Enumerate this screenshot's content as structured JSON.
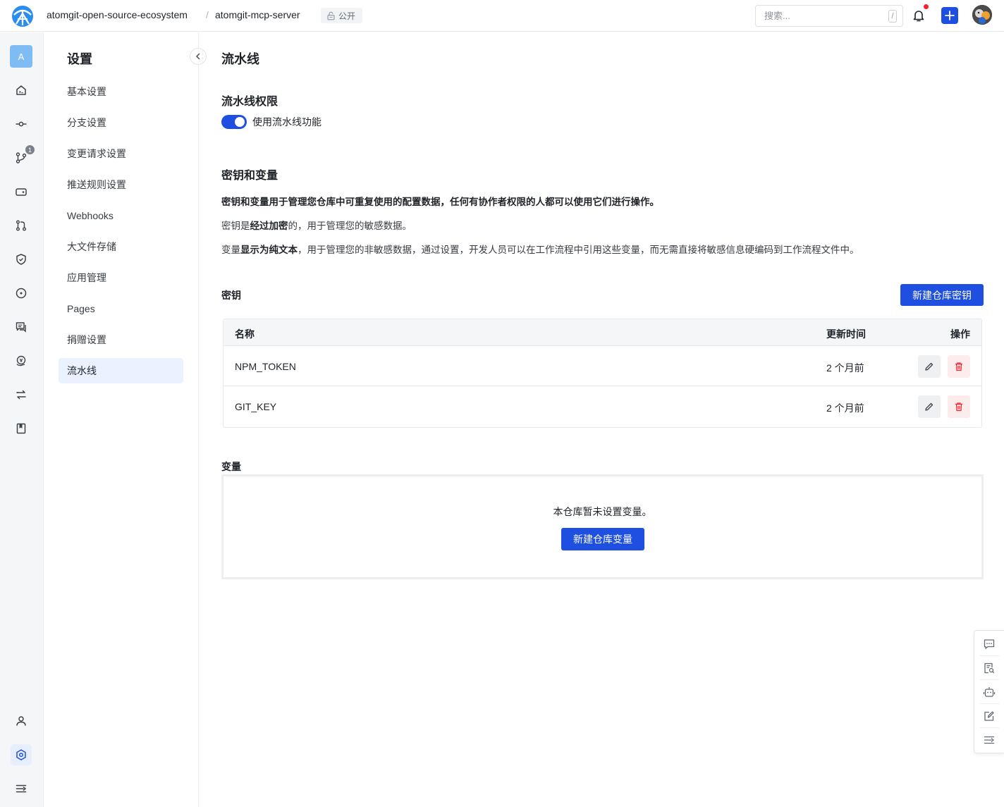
{
  "header": {
    "org": "atomgit-open-source-ecosystem",
    "separator": "/",
    "repo": "atomgit-mcp-server",
    "visibility": "公开",
    "search_placeholder": "搜索...",
    "search_shortcut": "/"
  },
  "rail": {
    "avatar_letter": "A",
    "badge_count": "1",
    "icons": [
      "home-icon",
      "commit-icon",
      "branch-icon",
      "tag-icon",
      "merge-request-icon",
      "security-icon",
      "issue-icon",
      "discussion-icon",
      "donation-icon",
      "sync-icon",
      "wiki-icon",
      "member-icon",
      "settings-icon",
      "expand-icon"
    ]
  },
  "sidebar": {
    "title": "设置",
    "items": [
      {
        "label": "基本设置"
      },
      {
        "label": "分支设置"
      },
      {
        "label": "变更请求设置"
      },
      {
        "label": "推送规则设置"
      },
      {
        "label": "Webhooks"
      },
      {
        "label": "大文件存储"
      },
      {
        "label": "应用管理"
      },
      {
        "label": "Pages"
      },
      {
        "label": "捐赠设置"
      },
      {
        "label": "流水线",
        "active": true
      }
    ]
  },
  "main": {
    "title": "流水线",
    "permission": {
      "heading": "流水线权限",
      "toggle_label": "使用流水线功能",
      "enabled": true
    },
    "secrets_vars": {
      "heading": "密钥和变量",
      "intro": "密钥和变量用于管理您仓库中可重复使用的配置数据，任何有协作者权限的人都可以使用它们进行操作。",
      "secret_desc_pre": "密钥是",
      "secret_desc_bold": "经过加密",
      "secret_desc_post": "的，用于管理您的敏感数据。",
      "var_desc_pre": "变量",
      "var_desc_bold": "显示为纯文本",
      "var_desc_post": "，用于管理您的非敏感数据，通过设置，开发人员可以在工作流程中引用这些变量，而无需直接将敏感信息硬编码到工作流程文件中。"
    },
    "secrets": {
      "heading": "密钥",
      "new_button": "新建仓库密钥",
      "columns": {
        "name": "名称",
        "updated": "更新时间",
        "actions": "操作"
      },
      "rows": [
        {
          "name": "NPM_TOKEN",
          "updated": "2 个月前"
        },
        {
          "name": "GIT_KEY",
          "updated": "2 个月前"
        }
      ]
    },
    "variables": {
      "heading": "变量",
      "empty_text": "本仓库暂未设置变量。",
      "new_button": "新建仓库变量"
    }
  },
  "colors": {
    "primary": "#1e4fe0",
    "active_bg": "#ebf2ff",
    "danger": "#f5222d"
  }
}
